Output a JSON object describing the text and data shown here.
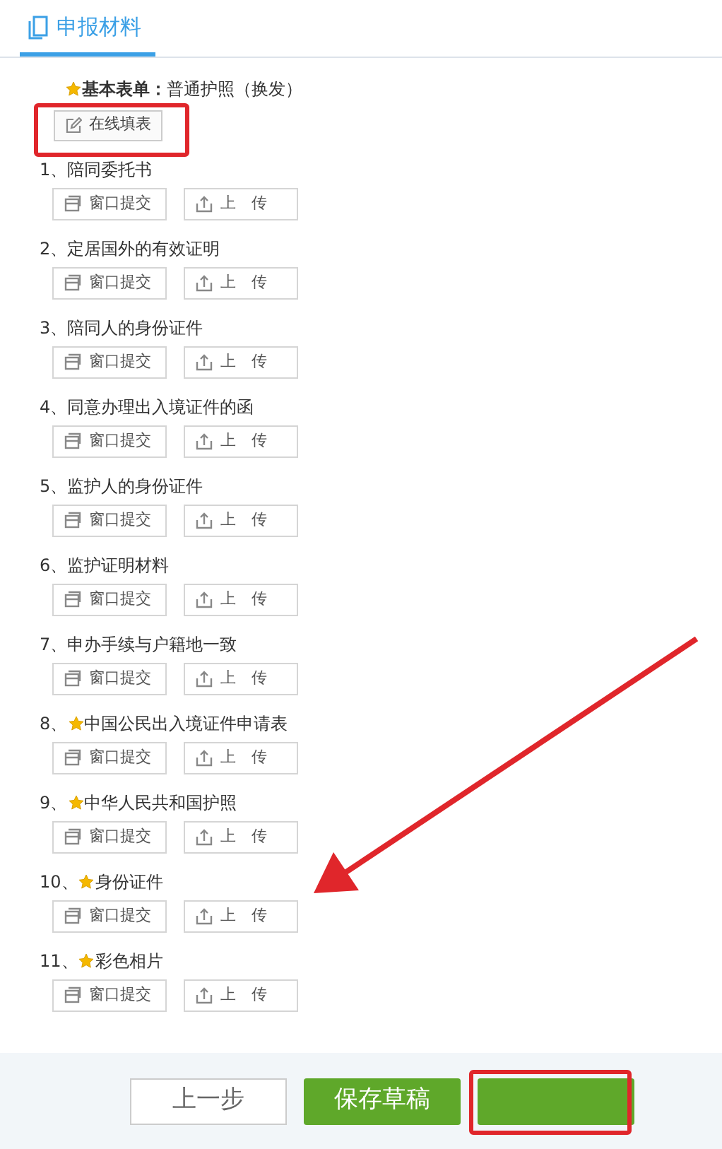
{
  "header": {
    "title": "申报材料"
  },
  "basic_form": {
    "label": "基本表单：",
    "value": "普通护照（换发）",
    "required": true,
    "button": "在线填表"
  },
  "items": [
    {
      "number": "1、",
      "title": "陪同委托书",
      "required": false,
      "window_button": "窗口提交",
      "upload_button": "上　传"
    },
    {
      "number": "2、",
      "title": "定居国外的有效证明",
      "required": false,
      "window_button": "窗口提交",
      "upload_button": "上　传"
    },
    {
      "number": "3、",
      "title": "陪同人的身份证件",
      "required": false,
      "window_button": "窗口提交",
      "upload_button": "上　传"
    },
    {
      "number": "4、",
      "title": "同意办理出入境证件的函",
      "required": false,
      "window_button": "窗口提交",
      "upload_button": "上　传"
    },
    {
      "number": "5、",
      "title": "监护人的身份证件",
      "required": false,
      "window_button": "窗口提交",
      "upload_button": "上　传"
    },
    {
      "number": "6、",
      "title": "监护证明材料",
      "required": false,
      "window_button": "窗口提交",
      "upload_button": "上　传"
    },
    {
      "number": "7、",
      "title": "申办手续与户籍地一致",
      "required": false,
      "window_button": "窗口提交",
      "upload_button": "上　传"
    },
    {
      "number": "8、",
      "title": "中国公民出入境证件申请表",
      "required": true,
      "window_button": "窗口提交",
      "upload_button": "上　传"
    },
    {
      "number": "9、",
      "title": "中华人民共和国护照",
      "required": true,
      "window_button": "窗口提交",
      "upload_button": "上　传"
    },
    {
      "number": "10、",
      "title": "身份证件",
      "required": true,
      "window_button": "窗口提交",
      "upload_button": "上　传"
    },
    {
      "number": "11、",
      "title": "彩色相片",
      "required": true,
      "window_button": "窗口提交",
      "upload_button": "上　传"
    }
  ],
  "footer_buttons": [
    {
      "kind": "outline",
      "label": "上一步"
    },
    {
      "kind": "primary",
      "label": "保存草稿"
    },
    {
      "kind": "primary"
    }
  ]
}
